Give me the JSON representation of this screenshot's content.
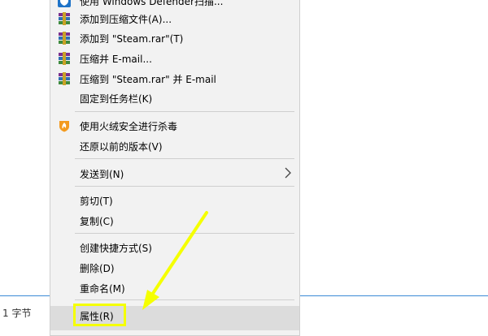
{
  "status": {
    "text": "1 字节"
  },
  "menu": {
    "items": [
      {
        "label": "使用 Windows Defender扫描...",
        "icon": "windows-defender-icon"
      },
      {
        "label": "添加到压缩文件(A)...",
        "icon": "winrar-icon"
      },
      {
        "label": "添加到 \"Steam.rar\"(T)",
        "icon": "winrar-icon"
      },
      {
        "label": "压缩并 E-mail...",
        "icon": "winrar-icon"
      },
      {
        "label": "压缩到 \"Steam.rar\" 并 E-mail",
        "icon": "winrar-icon"
      },
      {
        "label": "固定到任务栏(K)"
      },
      {
        "label": "使用火绒安全进行杀毒",
        "icon": "huorong-icon"
      },
      {
        "label": "还原以前的版本(V)"
      },
      {
        "label": "发送到(N)",
        "submenu": true
      },
      {
        "label": "剪切(T)"
      },
      {
        "label": "复制(C)"
      },
      {
        "label": "创建快捷方式(S)"
      },
      {
        "label": "删除(D)"
      },
      {
        "label": "重命名(M)"
      },
      {
        "label": "属性(R)",
        "highlighted": true
      }
    ]
  },
  "colors": {
    "highlight_box": "#f5ff00",
    "menu_bg": "#f2f2f2",
    "accent_line": "#3b8ad6"
  }
}
